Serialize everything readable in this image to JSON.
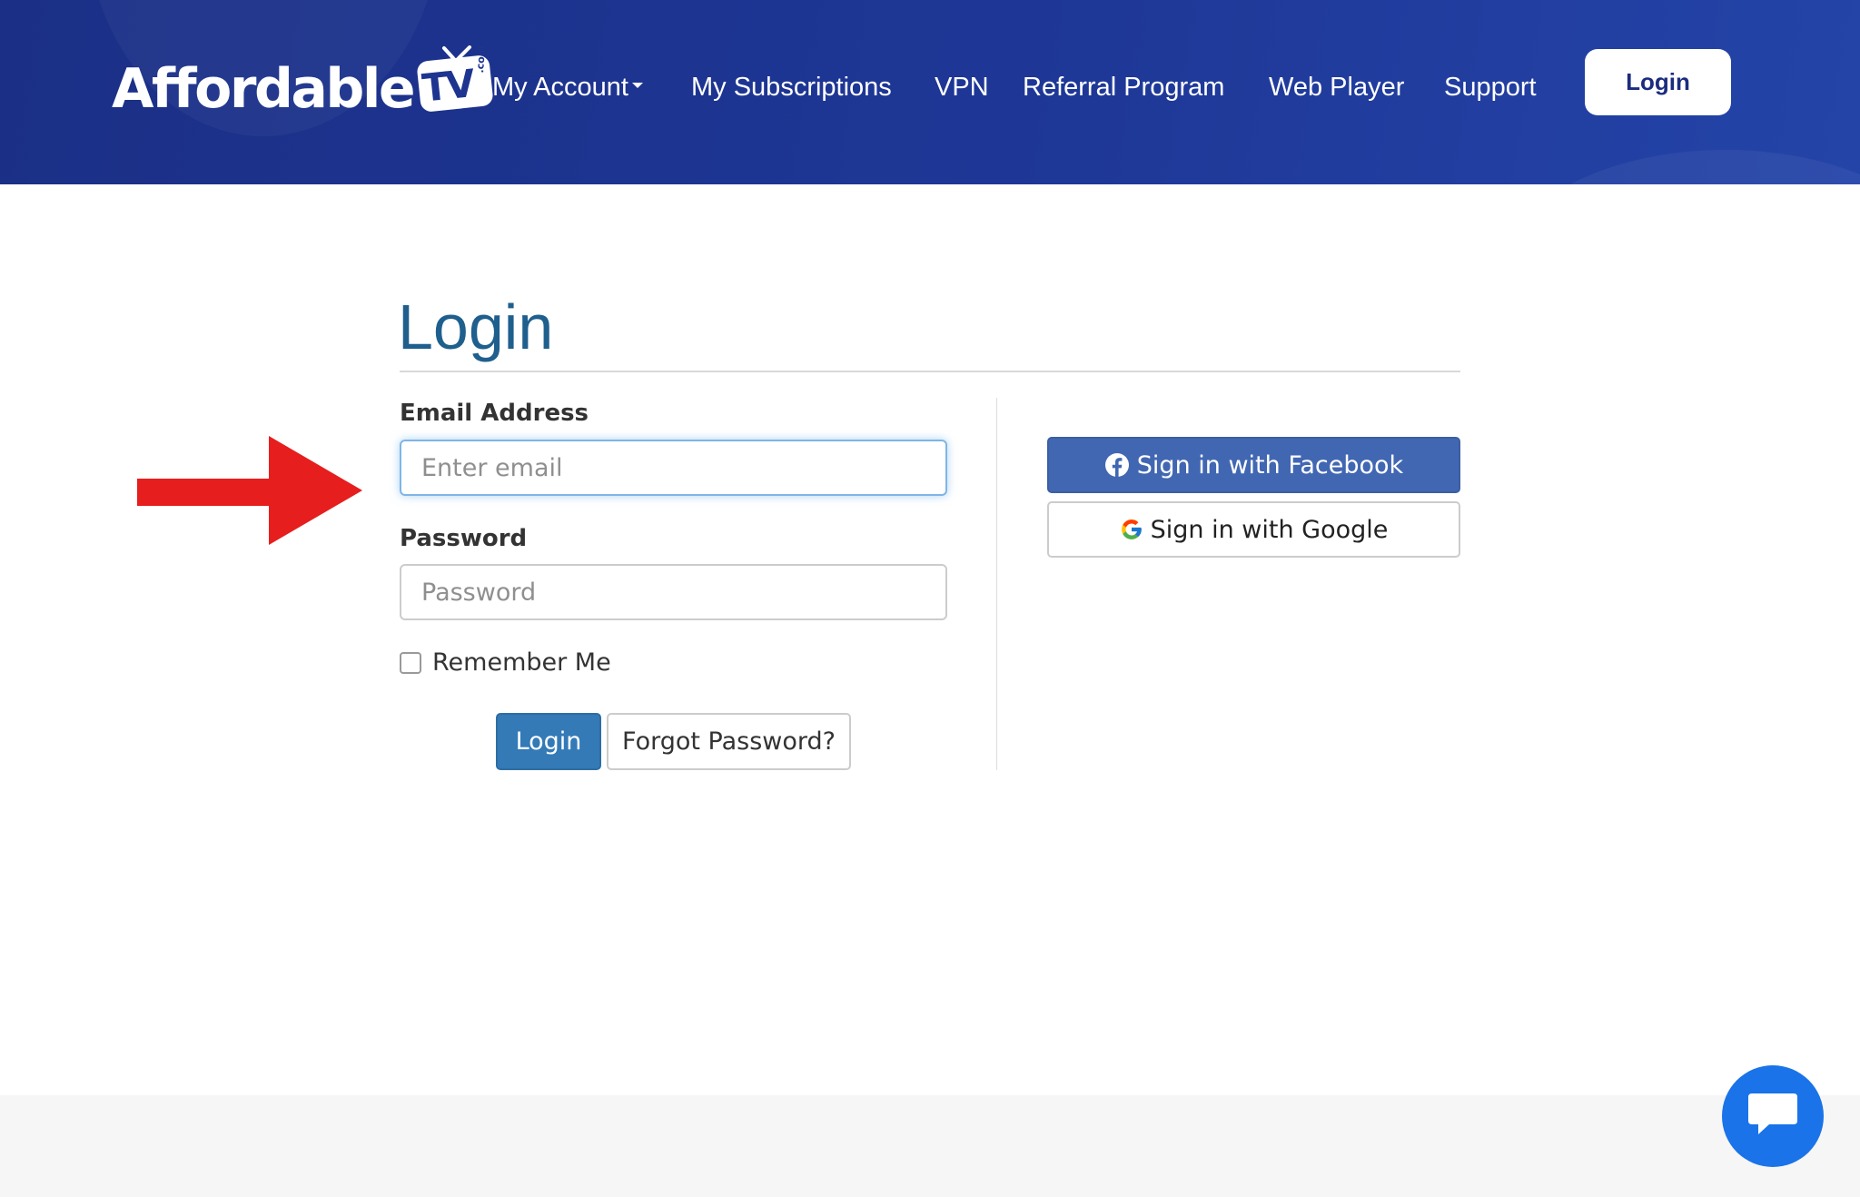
{
  "brand": {
    "logo_word": "Affordable",
    "logo_tv": "TV",
    "logo_com": ".com",
    "primary_color": "#1d3490",
    "accent_blue": "#337ab7",
    "facebook_blue": "#4267b2",
    "annotation_red": "#e61e1e",
    "chat_blue": "#1a73e8"
  },
  "nav": {
    "items": [
      {
        "label": "My Account",
        "has_dropdown": true
      },
      {
        "label": "My Subscriptions"
      },
      {
        "label": "VPN"
      },
      {
        "label": "Referral Program"
      },
      {
        "label": "Web Player"
      },
      {
        "label": "Support"
      }
    ],
    "login_label": "Login"
  },
  "login": {
    "title": "Login",
    "email_label": "Email Address",
    "email_placeholder": "Enter email",
    "password_label": "Password",
    "password_placeholder": "Password",
    "remember_label": "Remember Me",
    "submit_label": "Login",
    "forgot_label": "Forgot Password?"
  },
  "social": {
    "facebook_label": "Sign in with Facebook",
    "google_label": "Sign in with Google"
  },
  "icons": {
    "facebook": "facebook-icon",
    "google": "google-icon",
    "chat": "chat-icon",
    "annotation": "red-arrow"
  }
}
